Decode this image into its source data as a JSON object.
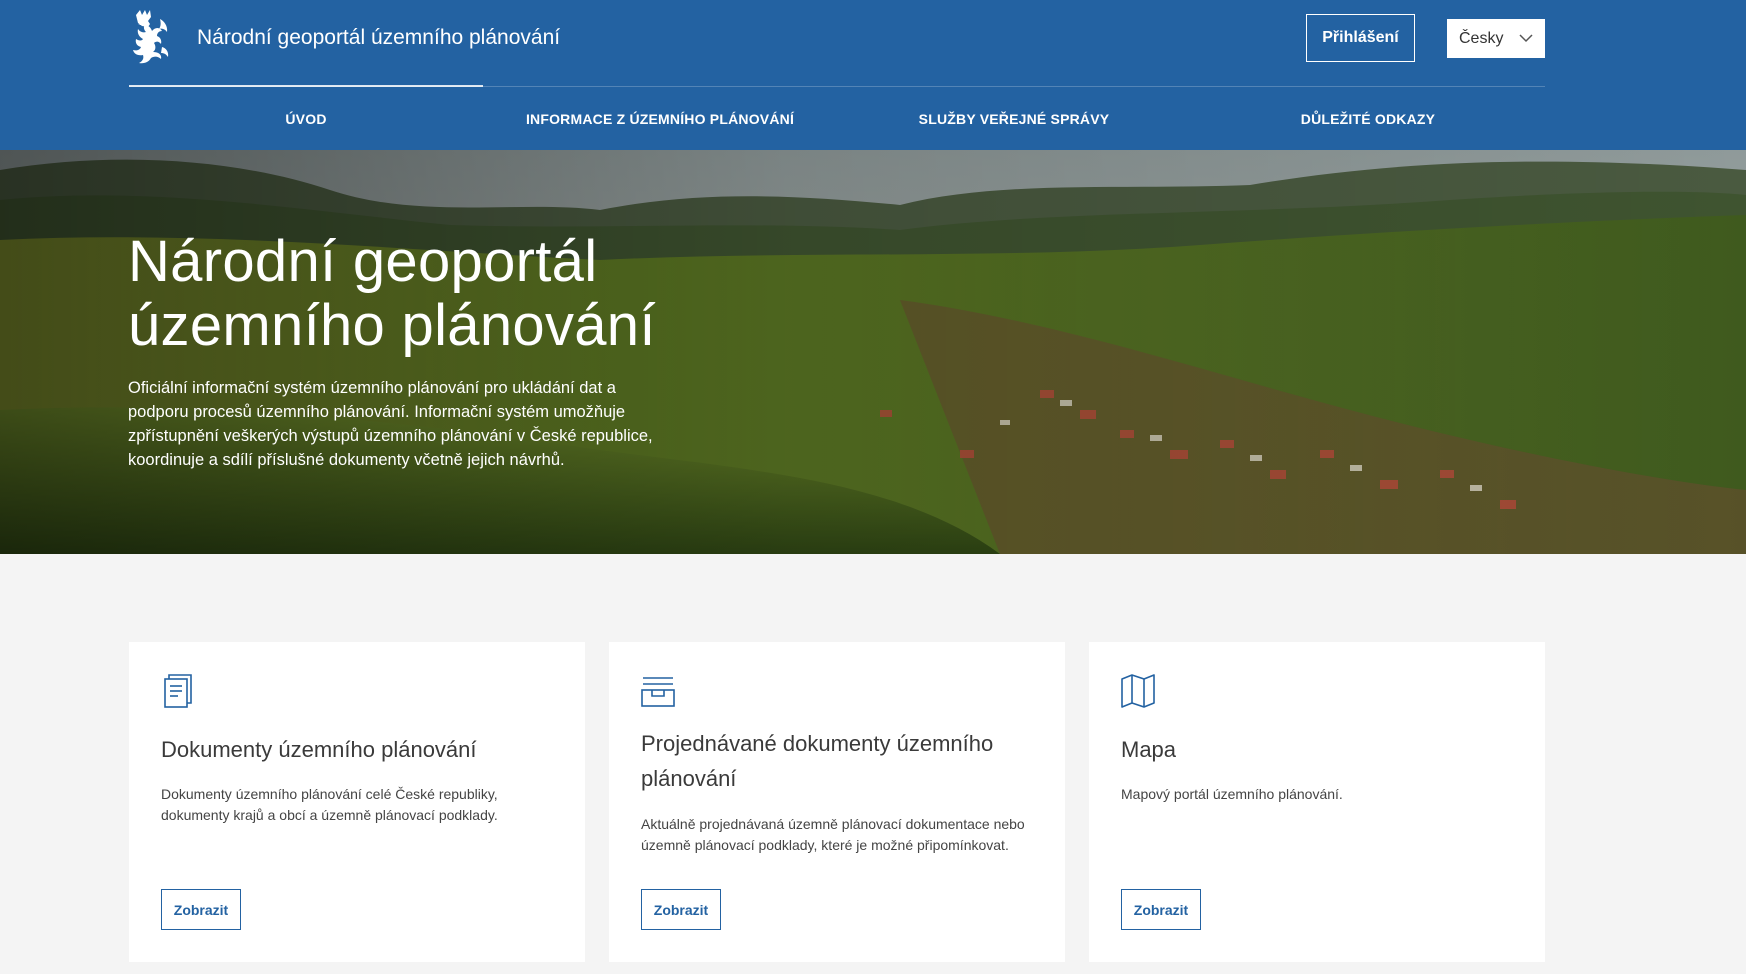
{
  "header": {
    "site_title": "Národní geoportál územního plánování",
    "login_label": "Přihlášení",
    "language": "Česky",
    "brand_color": "#2362a2"
  },
  "nav": {
    "items": [
      {
        "label": "Úvod",
        "active": true
      },
      {
        "label": "Informace z územního plánování",
        "active": false
      },
      {
        "label": "Služby veřejné správy",
        "active": false
      },
      {
        "label": "Důležité odkazy",
        "active": false
      }
    ]
  },
  "hero": {
    "title_line1": "Národní geoportál",
    "title_line2": "územního plánování",
    "description": "Oficiální informační systém územního plánování pro ukládání dat a podporu procesů územního plánování. Informační systém umožňuje zpřístupnění veškerých výstupů územního plánování v České republice, koordinuje a sdílí příslušné dokumenty včetně jejich návrhů."
  },
  "cards": [
    {
      "icon": "document-icon",
      "title": "Dokumenty územního plánování",
      "text": "Dokumenty územního plánování celé České republiky, dokumenty krajů a obcí a územně plánovací podklady.",
      "button": "Zobrazit"
    },
    {
      "icon": "inbox-icon",
      "title": "Projednávané dokumenty územního plánování",
      "text": "Aktuálně projednávaná územně plánovací dokumentace nebo územně plánovací podklady, které je možné připomínkovat.",
      "button": "Zobrazit"
    },
    {
      "icon": "map-icon",
      "title": "Mapa",
      "text": "Mapový portál územního plánování.",
      "button": "Zobrazit"
    }
  ]
}
